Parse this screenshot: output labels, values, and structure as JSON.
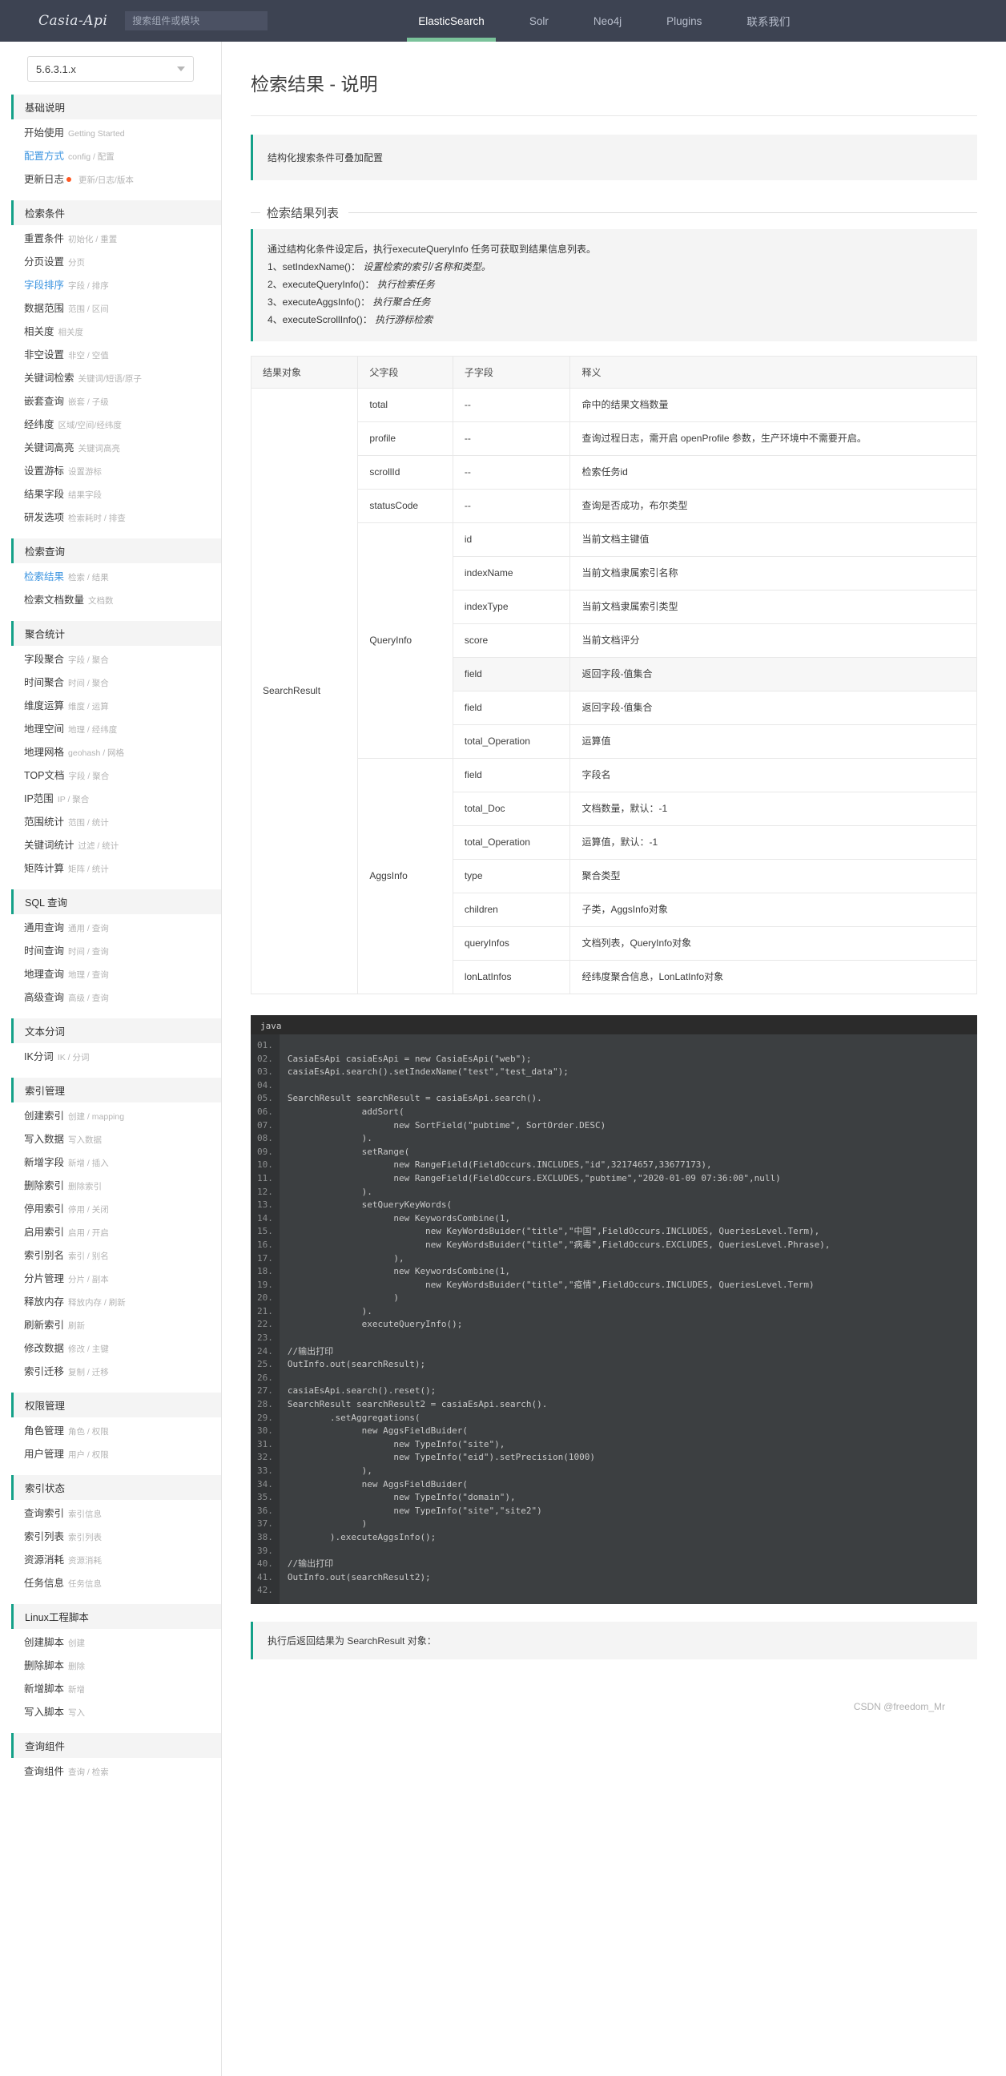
{
  "header": {
    "brand": "Casia-Api",
    "search_placeholder": "搜索组件或模块",
    "search_value": "",
    "nav": [
      {
        "label": "ElasticSearch",
        "active": true
      },
      {
        "label": "Solr",
        "active": false
      },
      {
        "label": "Neo4j",
        "active": false
      },
      {
        "label": "Plugins",
        "active": false
      },
      {
        "label": "联系我们",
        "active": false
      }
    ],
    "accent_color": "#7ac29a",
    "bg_color": "#3d4352"
  },
  "sidebar": {
    "version": "5.6.3.1.x",
    "groups": [
      {
        "title": "基础说明",
        "items": [
          {
            "label": "开始使用",
            "sub": "Getting Started",
            "link": false,
            "new": false
          },
          {
            "label": "配置方式",
            "sub": "config / 配置",
            "link": true,
            "new": false
          },
          {
            "label": "更新日志",
            "sub": "更新/日志/版本",
            "link": false,
            "new": true
          }
        ]
      },
      {
        "title": "检索条件",
        "items": [
          {
            "label": "重置条件",
            "sub": "初始化 / 重置",
            "link": false,
            "new": false
          },
          {
            "label": "分页设置",
            "sub": "分页",
            "link": false,
            "new": false
          },
          {
            "label": "字段排序",
            "sub": "字段 / 排序",
            "link": true,
            "new": false
          },
          {
            "label": "数据范围",
            "sub": "范围 / 区间",
            "link": false,
            "new": false
          },
          {
            "label": "相关度",
            "sub": "相关度",
            "link": false,
            "new": false
          },
          {
            "label": "非空设置",
            "sub": "非空 / 空值",
            "link": false,
            "new": false
          },
          {
            "label": "关键词检索",
            "sub": "关键词/短语/原子",
            "link": false,
            "new": false
          },
          {
            "label": "嵌套查询",
            "sub": "嵌套 / 子级",
            "link": false,
            "new": false
          },
          {
            "label": "经纬度",
            "sub": "区域/空间/经纬度",
            "link": false,
            "new": false
          },
          {
            "label": "关键词高亮",
            "sub": "关键词高亮",
            "link": false,
            "new": false
          },
          {
            "label": "设置游标",
            "sub": "设置游标",
            "link": false,
            "new": false
          },
          {
            "label": "结果字段",
            "sub": "结果字段",
            "link": false,
            "new": false
          },
          {
            "label": "研发选项",
            "sub": "检索耗时 / 排查",
            "link": false,
            "new": false
          }
        ]
      },
      {
        "title": "检索查询",
        "items": [
          {
            "label": "检索结果",
            "sub": "检索 / 结果",
            "link": true,
            "new": false
          },
          {
            "label": "检索文档数量",
            "sub": "文档数",
            "link": false,
            "new": false
          }
        ]
      },
      {
        "title": "聚合统计",
        "items": [
          {
            "label": "字段聚合",
            "sub": "字段 / 聚合",
            "link": false,
            "new": false
          },
          {
            "label": "时间聚合",
            "sub": "时间 / 聚合",
            "link": false,
            "new": false
          },
          {
            "label": "维度运算",
            "sub": "维度 / 运算",
            "link": false,
            "new": false
          },
          {
            "label": "地理空间",
            "sub": "地理 / 经纬度",
            "link": false,
            "new": false
          },
          {
            "label": "地理网格",
            "sub": "geohash / 网格",
            "link": false,
            "new": false
          },
          {
            "label": "TOP文档",
            "sub": "字段 / 聚合",
            "link": false,
            "new": false
          },
          {
            "label": "IP范围",
            "sub": "IP / 聚合",
            "link": false,
            "new": false
          },
          {
            "label": "范围统计",
            "sub": "范围 / 统计",
            "link": false,
            "new": false
          },
          {
            "label": "关键词统计",
            "sub": "过滤 / 统计",
            "link": false,
            "new": false
          },
          {
            "label": "矩阵计算",
            "sub": "矩阵 / 统计",
            "link": false,
            "new": false
          }
        ]
      },
      {
        "title": "SQL 查询",
        "items": [
          {
            "label": "通用查询",
            "sub": "通用 / 查询",
            "link": false,
            "new": false
          },
          {
            "label": "时间查询",
            "sub": "时间 / 查询",
            "link": false,
            "new": false
          },
          {
            "label": "地理查询",
            "sub": "地理 / 查询",
            "link": false,
            "new": false
          },
          {
            "label": "高级查询",
            "sub": "高级 / 查询",
            "link": false,
            "new": false
          }
        ]
      },
      {
        "title": "文本分词",
        "items": [
          {
            "label": "IK分词",
            "sub": "IK / 分词",
            "link": false,
            "new": false
          }
        ]
      },
      {
        "title": "索引管理",
        "items": [
          {
            "label": "创建索引",
            "sub": "创建 / mapping",
            "link": false,
            "new": false
          },
          {
            "label": "写入数据",
            "sub": "写入数据",
            "link": false,
            "new": false
          },
          {
            "label": "新增字段",
            "sub": "新增 / 插入",
            "link": false,
            "new": false
          },
          {
            "label": "删除索引",
            "sub": "删除索引",
            "link": false,
            "new": false
          },
          {
            "label": "停用索引",
            "sub": "停用 / 关闭",
            "link": false,
            "new": false
          },
          {
            "label": "启用索引",
            "sub": "启用 / 开启",
            "link": false,
            "new": false
          },
          {
            "label": "索引别名",
            "sub": "索引 / 别名",
            "link": false,
            "new": false
          },
          {
            "label": "分片管理",
            "sub": "分片 / 副本",
            "link": false,
            "new": false
          },
          {
            "label": "释放内存",
            "sub": "释放内存 / 刷新",
            "link": false,
            "new": false
          },
          {
            "label": "刷新索引",
            "sub": "刷新",
            "link": false,
            "new": false
          },
          {
            "label": "修改数据",
            "sub": "修改 / 主键",
            "link": false,
            "new": false
          },
          {
            "label": "索引迁移",
            "sub": "复制 / 迁移",
            "link": false,
            "new": false
          }
        ]
      },
      {
        "title": "权限管理",
        "items": [
          {
            "label": "角色管理",
            "sub": "角色 / 权限",
            "link": false,
            "new": false
          },
          {
            "label": "用户管理",
            "sub": "用户 / 权限",
            "link": false,
            "new": false
          }
        ]
      },
      {
        "title": "索引状态",
        "items": [
          {
            "label": "查询索引",
            "sub": "索引信息",
            "link": false,
            "new": false
          },
          {
            "label": "索引列表",
            "sub": "索引列表",
            "link": false,
            "new": false
          },
          {
            "label": "资源消耗",
            "sub": "资源消耗",
            "link": false,
            "new": false
          },
          {
            "label": "任务信息",
            "sub": "任务信息",
            "link": false,
            "new": false
          }
        ]
      },
      {
        "title": "Linux工程脚本",
        "items": [
          {
            "label": "创建脚本",
            "sub": "创建",
            "link": false,
            "new": false
          },
          {
            "label": "删除脚本",
            "sub": "删除",
            "link": false,
            "new": false
          },
          {
            "label": "新增脚本",
            "sub": "新增",
            "link": false,
            "new": false
          },
          {
            "label": "写入脚本",
            "sub": "写入",
            "link": false,
            "new": false
          }
        ]
      },
      {
        "title": "查询组件",
        "items": [
          {
            "label": "查询组件",
            "sub": "查询 / 检索",
            "link": false,
            "new": false
          }
        ]
      }
    ]
  },
  "main": {
    "page_title": "检索结果 - 说明",
    "note": "结构化搜索条件可叠加配置",
    "section_legend": "检索结果列表",
    "description": {
      "intro": "通过结构化条件设定后，执行executeQueryInfo 任务可获取到结果信息列表。",
      "steps": [
        {
          "no": "1、",
          "api": "setIndexName()：",
          "desc": "设置检索的索引/名称和类型。"
        },
        {
          "no": "2、",
          "api": "executeQueryInfo()：",
          "desc": "执行检索任务"
        },
        {
          "no": "3、",
          "api": "executeAggsInfo()：",
          "desc": "执行聚合任务"
        },
        {
          "no": "4、",
          "api": "executeScrollInfo()：",
          "desc": "执行游标检索"
        }
      ]
    },
    "table": {
      "headers": [
        "结果对象",
        "父字段",
        "子字段",
        "释义"
      ],
      "result_object": "SearchResult",
      "rows": [
        {
          "parent": "total",
          "child": "--",
          "desc": "命中的结果文档数量",
          "shade": false,
          "group": ""
        },
        {
          "parent": "profile",
          "child": "--",
          "desc": "查询过程日志，需开启 openProfile 参数，生产环境中不需要开启。",
          "shade": false,
          "group": ""
        },
        {
          "parent": "scrollId",
          "child": "--",
          "desc": "检索任务id",
          "shade": false,
          "group": ""
        },
        {
          "parent": "statusCode",
          "child": "--",
          "desc": "查询是否成功，布尔类型",
          "shade": false,
          "group": ""
        },
        {
          "parent": "",
          "child": "id",
          "desc": "当前文档主键值",
          "shade": false,
          "group": "QueryInfo"
        },
        {
          "parent": "",
          "child": "indexName",
          "desc": "当前文档隶属索引名称",
          "shade": false,
          "group": "QueryInfo"
        },
        {
          "parent": "",
          "child": "indexType",
          "desc": "当前文档隶属索引类型",
          "shade": false,
          "group": "QueryInfo"
        },
        {
          "parent": "QueryInfo",
          "child": "score",
          "desc": "当前文档评分",
          "shade": false,
          "group": "QueryInfo"
        },
        {
          "parent": "",
          "child": "field",
          "desc": "返回字段-值集合",
          "shade": true,
          "group": "QueryInfo"
        },
        {
          "parent": "",
          "child": "field",
          "desc": "返回字段-值集合",
          "shade": false,
          "group": "QueryInfo"
        },
        {
          "parent": "",
          "child": "total_Operation",
          "desc": "运算值",
          "shade": false,
          "group": "QueryInfo"
        },
        {
          "parent": "",
          "child": "field",
          "desc": "字段名",
          "shade": false,
          "group": "AggsInfo"
        },
        {
          "parent": "",
          "child": "total_Doc",
          "desc": "文档数量，默认：-1",
          "shade": false,
          "group": "AggsInfo"
        },
        {
          "parent": "",
          "child": "total_Operation",
          "desc": "运算值，默认：-1",
          "shade": false,
          "group": "AggsInfo"
        },
        {
          "parent": "AggsInfo",
          "child": "type",
          "desc": "聚合类型",
          "shade": false,
          "group": "AggsInfo"
        },
        {
          "parent": "",
          "child": "children",
          "desc": "子类，AggsInfo对象",
          "shade": false,
          "group": "AggsInfo"
        },
        {
          "parent": "",
          "child": "queryInfos",
          "desc": "文档列表，QueryInfo对象",
          "shade": false,
          "group": "AggsInfo"
        },
        {
          "parent": "",
          "child": "lonLatInfos",
          "desc": "经纬度聚合信息，LonLatInfo对象",
          "shade": false,
          "group": "AggsInfo"
        }
      ]
    },
    "code": {
      "language": "java",
      "line_numbers": [
        "01.",
        "02.",
        "03.",
        "04.",
        "05.",
        "06.",
        "07.",
        "08.",
        "09.",
        "10.",
        "11.",
        "12.",
        "13.",
        "14.",
        "15.",
        "16.",
        "17.",
        "18.",
        "19.",
        "20.",
        "21.",
        "22.",
        "23.",
        "24.",
        "25.",
        "26.",
        "27.",
        "28.",
        "29.",
        "30.",
        "31.",
        "32.",
        "33.",
        "34.",
        "35.",
        "36.",
        "37.",
        "38.",
        "39.",
        "40.",
        "41.",
        "42."
      ],
      "lines": [
        "",
        "CasiaEsApi casiaEsApi = new CasiaEsApi(\"web\");",
        "casiaEsApi.search().setIndexName(\"test\",\"test_data\");",
        "",
        "SearchResult searchResult = casiaEsApi.search().",
        "              addSort(",
        "                    new SortField(\"pubtime\", SortOrder.DESC)",
        "              ).",
        "              setRange(",
        "                    new RangeField(FieldOccurs.INCLUDES,\"id\",32174657,33677173),",
        "                    new RangeField(FieldOccurs.EXCLUDES,\"pubtime\",\"2020-01-09 07:36:00\",null)",
        "              ).",
        "              setQueryKeyWords(",
        "                    new KeywordsCombine(1,",
        "                          new KeyWordsBuider(\"title\",\"中国\",FieldOccurs.INCLUDES, QueriesLevel.Term),",
        "                          new KeyWordsBuider(\"title\",\"病毒\",FieldOccurs.EXCLUDES, QueriesLevel.Phrase),",
        "                    ),",
        "                    new KeywordsCombine(1,",
        "                          new KeyWordsBuider(\"title\",\"疫情\",FieldOccurs.INCLUDES, QueriesLevel.Term)",
        "                    )",
        "              ).",
        "              executeQueryInfo();",
        "",
        "//输出打印",
        "OutInfo.out(searchResult);",
        "",
        "casiaEsApi.search().reset();",
        "SearchResult searchResult2 = casiaEsApi.search().",
        "        .setAggregations(",
        "              new AggsFieldBuider(",
        "                    new TypeInfo(\"site\"),",
        "                    new TypeInfo(\"eid\").setPrecision(1000)",
        "              ),",
        "              new AggsFieldBuider(",
        "                    new TypeInfo(\"domain\"),",
        "                    new TypeInfo(\"site\",\"site2\")",
        "              )",
        "        ).executeAggsInfo();",
        "",
        "//输出打印",
        "OutInfo.out(searchResult2);",
        ""
      ]
    },
    "post_note": "执行后返回结果为 SearchResult 对象："
  },
  "watermark": "CSDN @freedom_Mr"
}
